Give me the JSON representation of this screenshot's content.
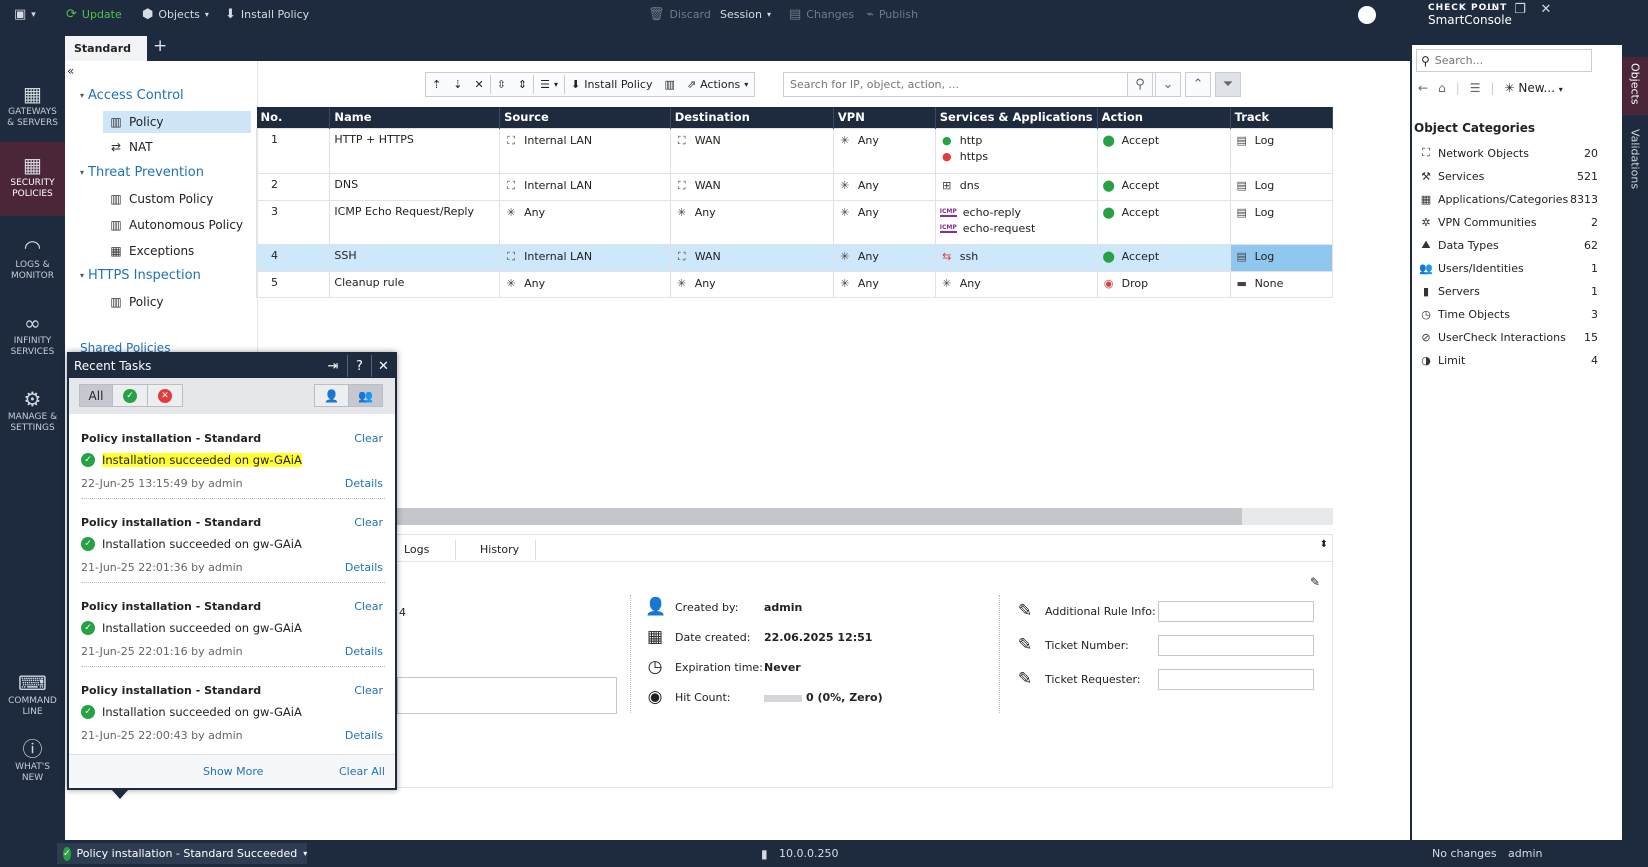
{
  "topbar": {
    "update": "Update",
    "objects": "Objects",
    "install_policy": "Install Policy",
    "discard": "Discard",
    "session": "Session",
    "changes": "Changes",
    "publish": "Publish",
    "brand_line1": "CHECK POINT",
    "brand_line2": "SmartConsole"
  },
  "sidebar": {
    "items": [
      {
        "label1": "GATEWAYS",
        "label2": "& SERVERS"
      },
      {
        "label1": "SECURITY",
        "label2": "POLICIES"
      },
      {
        "label1": "LOGS &",
        "label2": "MONITOR"
      },
      {
        "label1": "INFINITY",
        "label2": "SERVICES"
      },
      {
        "label1": "MANAGE &",
        "label2": "SETTINGS"
      },
      {
        "label1": "COMMAND",
        "label2": "LINE"
      },
      {
        "label1": "WHAT'S",
        "label2": "NEW"
      }
    ]
  },
  "tabs": {
    "active": "Standard"
  },
  "tree": {
    "collapse": "«",
    "access_control": "Access Control",
    "policy": "Policy",
    "nat": "NAT",
    "threat_prevention": "Threat Prevention",
    "custom_policy": "Custom Policy",
    "autonomous_policy": "Autonomous Policy",
    "exceptions": "Exceptions",
    "https_inspection": "HTTPS Inspection",
    "https_policy": "Policy",
    "shared_policies": "Shared Policies"
  },
  "toolbar": {
    "install_policy": "Install Policy",
    "actions": "Actions",
    "search_placeholder": "Search for IP, object, action, ..."
  },
  "table": {
    "headers": [
      "No.",
      "Name",
      "Source",
      "Destination",
      "VPN",
      "Services & Applications",
      "Action",
      "Track"
    ],
    "rows": [
      {
        "no": "1",
        "name": "HTTP + HTTPS",
        "source": "Internal LAN",
        "dest": "WAN",
        "vpn": "Any",
        "svc1": "http",
        "svc2": "https",
        "action": "Accept",
        "track": "Log"
      },
      {
        "no": "2",
        "name": "DNS",
        "source": "Internal LAN",
        "dest": "WAN",
        "vpn": "Any",
        "svc1": "dns",
        "action": "Accept",
        "track": "Log"
      },
      {
        "no": "3",
        "name": "ICMP Echo Request/Reply",
        "source": "Any",
        "dest": "Any",
        "vpn": "Any",
        "svc1": "echo-reply",
        "svc2": "echo-request",
        "action": "Accept",
        "track": "Log"
      },
      {
        "no": "4",
        "name": "SSH",
        "source": "Internal LAN",
        "dest": "WAN",
        "vpn": "Any",
        "svc1": "ssh",
        "action": "Accept",
        "track": "Log"
      },
      {
        "no": "5",
        "name": "Cleanup rule",
        "source": "Any",
        "dest": "Any",
        "vpn": "Any",
        "svc1": "Any",
        "action": "Drop",
        "track": "None"
      }
    ],
    "icmp_tag": "ICMP"
  },
  "details": {
    "tab_logs": "Logs",
    "tab_history": "History",
    "partial_number": "4",
    "created_by_label": "Created by:",
    "created_by": "admin",
    "date_created_label": "Date created:",
    "date_created": "22.06.2025 12:51",
    "expiration_label": "Expiration time:",
    "expiration": "Never",
    "hit_count_label": "Hit Count:",
    "hit_count": "0 (0%, Zero)",
    "additional_info_label": "Additional Rule Info:",
    "ticket_number_label": "Ticket Number:",
    "ticket_requester_label": "Ticket Requester:"
  },
  "recent_tasks": {
    "title": "Recent Tasks",
    "filter_all": "All",
    "tasks": [
      {
        "title": "Policy installation - Standard",
        "msg": "Installation succeeded on gw-GAiA",
        "time": "22-Jun-25 13:15:49",
        "by": "by admin",
        "highlight": true
      },
      {
        "title": "Policy installation - Standard",
        "msg": "Installation succeeded on gw-GAiA",
        "time": "21-Jun-25 22:01:36",
        "by": "by admin",
        "highlight": false
      },
      {
        "title": "Policy installation - Standard",
        "msg": "Installation succeeded on gw-GAiA",
        "time": "21-Jun-25 22:01:16",
        "by": "by admin",
        "highlight": false
      },
      {
        "title": "Policy installation - Standard",
        "msg": "Installation succeeded on gw-GAiA",
        "time": "21-Jun-25 22:00:43",
        "by": "by admin",
        "highlight": false
      }
    ],
    "clear": "Clear",
    "details": "Details",
    "show_more": "Show More",
    "clear_all": "Clear All"
  },
  "objects_panel": {
    "search_placeholder": "Search...",
    "new": "New...",
    "heading": "Object Categories",
    "categories": [
      {
        "name": "Network Objects",
        "count": "20",
        "icon": "network-icon"
      },
      {
        "name": "Services",
        "count": "521",
        "icon": "services-icon"
      },
      {
        "name": "Applications/Categories",
        "count": "8313",
        "icon": "apps-icon"
      },
      {
        "name": "VPN Communities",
        "count": "2",
        "icon": "vpn-icon"
      },
      {
        "name": "Data Types",
        "count": "62",
        "icon": "data-types-icon"
      },
      {
        "name": "Users/Identities",
        "count": "1",
        "icon": "users-icon"
      },
      {
        "name": "Servers",
        "count": "1",
        "icon": "server-icon"
      },
      {
        "name": "Time Objects",
        "count": "3",
        "icon": "clock-icon"
      },
      {
        "name": "UserCheck Interactions",
        "count": "15",
        "icon": "usercheck-icon"
      },
      {
        "name": "Limit",
        "count": "4",
        "icon": "limit-icon"
      }
    ],
    "vtab_objects": "Objects",
    "vtab_validations": "Validations"
  },
  "status": {
    "task": "Policy installation - Standard Succeeded",
    "server": "10.0.0.250",
    "changes": "No changes",
    "user": "admin"
  },
  "colors": {
    "navy": "#1e2a3d",
    "accent": "#1f72b5",
    "success": "#26a244",
    "drop": "#e03c3c",
    "highlight": "#ffff33"
  }
}
